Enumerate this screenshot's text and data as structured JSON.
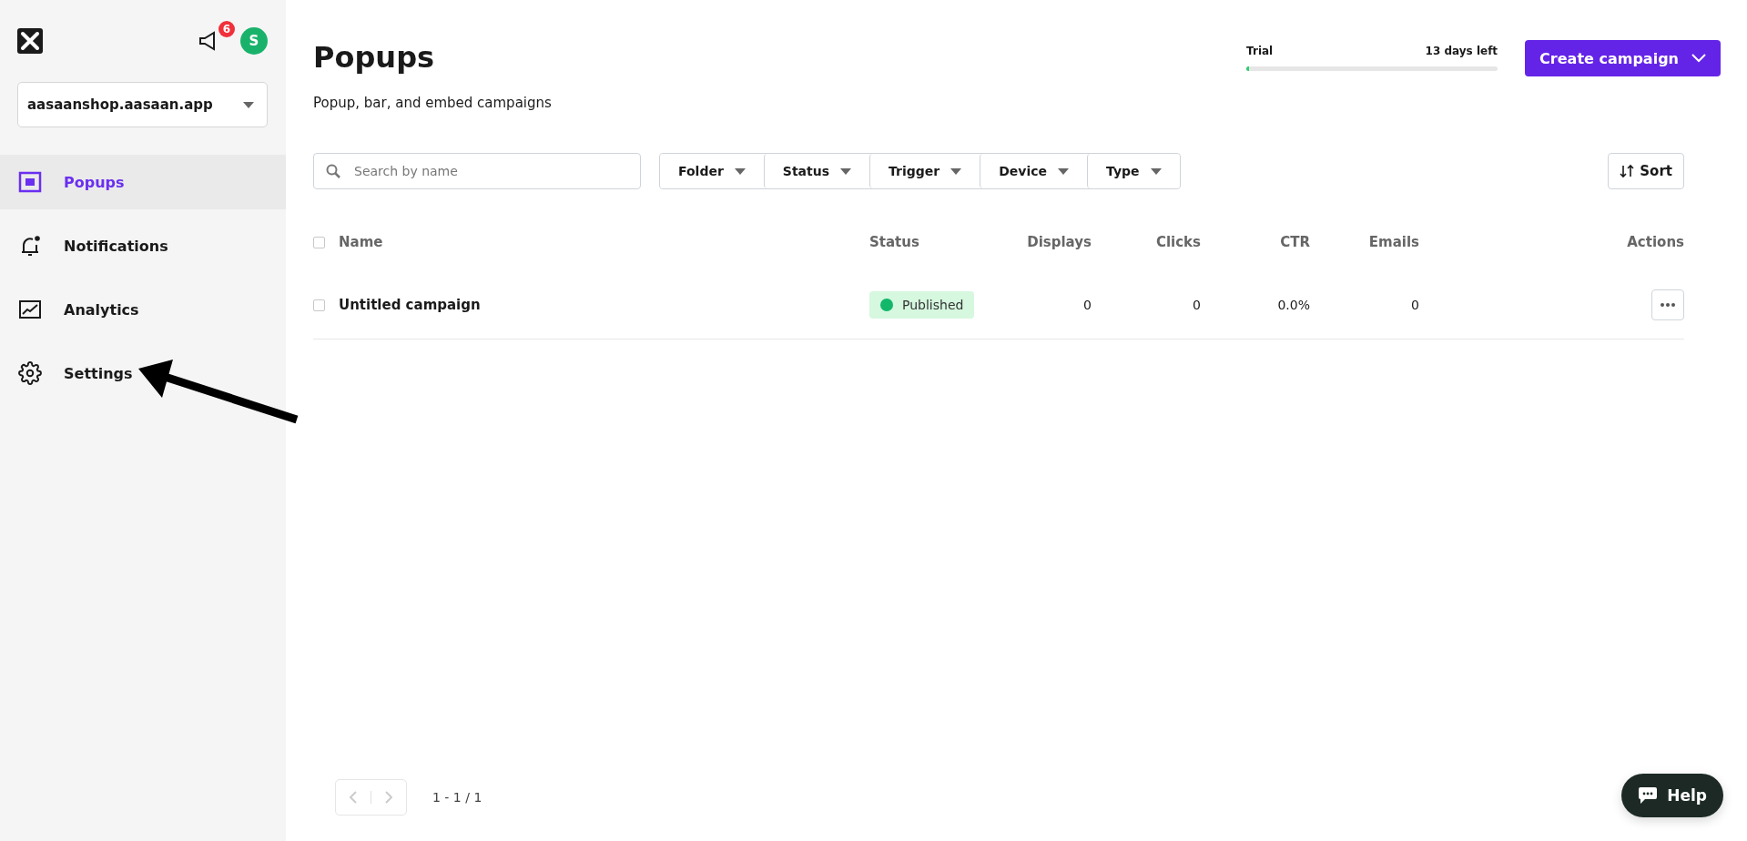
{
  "sidebar": {
    "notification_count": "6",
    "avatar_initial": "S",
    "site_select": {
      "value": "aasaanshop.aasaan.app"
    },
    "items": [
      {
        "label": "Popups",
        "selected": true
      },
      {
        "label": "Notifications",
        "selected": false
      },
      {
        "label": "Analytics",
        "selected": false
      },
      {
        "label": "Settings",
        "selected": false
      }
    ]
  },
  "header": {
    "title": "Popups",
    "subtitle": "Popup, bar, and embed campaigns",
    "trial": {
      "label": "Trial",
      "remaining": "13 days left",
      "level": 0.01
    },
    "create_button": "Create campaign"
  },
  "search": {
    "placeholder": "Search by name"
  },
  "filters": [
    "Folder",
    "Status",
    "Trigger",
    "Device",
    "Type"
  ],
  "sort_button": "Sort",
  "table": {
    "select_all_checked": false,
    "columns": [
      "Name",
      "Status",
      "Displays",
      "Clicks",
      "CTR",
      "Emails",
      "Actions"
    ],
    "rows": [
      {
        "checked": false,
        "name": "Untitled campaign",
        "status": "Published",
        "color": "#12b76a",
        "displays": "0",
        "clicks": "0",
        "ctr": "0.0%",
        "emails": "0"
      }
    ]
  },
  "pagination": {
    "range": "1 - 1 / 1"
  },
  "help_button": "Help"
}
